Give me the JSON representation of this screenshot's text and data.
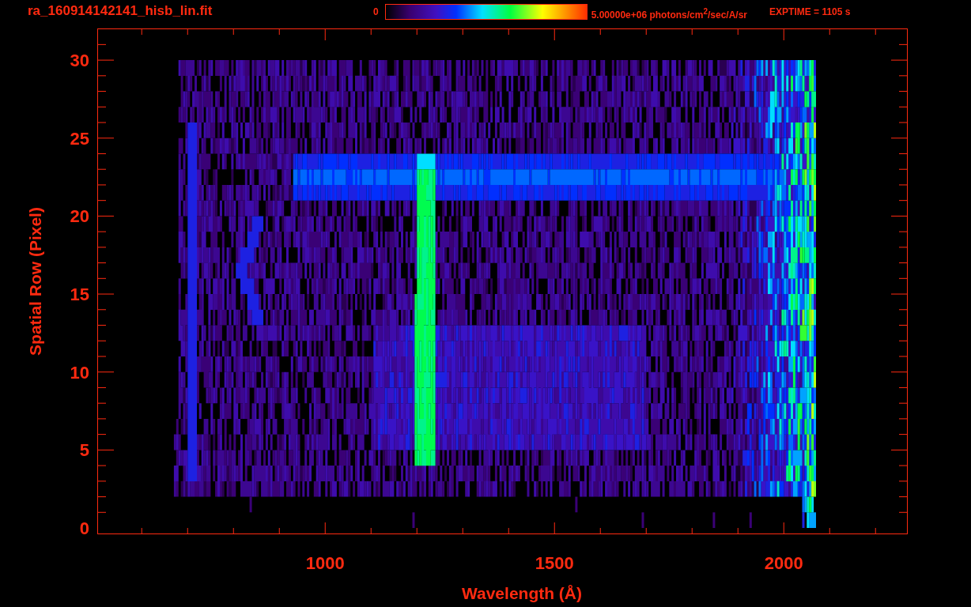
{
  "header": {
    "filename": "ra_160914142141_hisb_lin.fit",
    "colorbar": {
      "min_label": "0",
      "max_label": "5.00000e+06 photons/cm$^{2}$/sec/A/sr"
    },
    "exposure": "EXPTIME = 1105 s"
  },
  "plot": {
    "xlabel": "Wavelength (Å)",
    "ylabel": "Spatial Row (Pixel)",
    "xticks": [
      "1000",
      "1500",
      "2000"
    ],
    "yticks": [
      "30",
      "25",
      "20",
      "15",
      "10",
      "5",
      "0"
    ]
  }
}
